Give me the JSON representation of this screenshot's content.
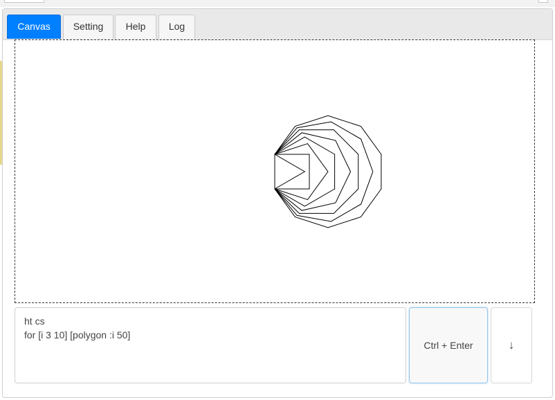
{
  "tabs": [
    {
      "label": "Canvas",
      "active": true
    },
    {
      "label": "Setting",
      "active": false
    },
    {
      "label": "Help",
      "active": false
    },
    {
      "label": "Log",
      "active": false
    }
  ],
  "editor": {
    "lines": [
      "ht cs",
      "for [i 3 10] [polygon :i 50]"
    ]
  },
  "buttons": {
    "run_label": "Ctrl + Enter",
    "down_label": "↓"
  },
  "drawing": {
    "shape": "polygon",
    "sides_from": 3,
    "sides_to": 10,
    "side_length": 50,
    "stroke_color": "#000000"
  },
  "colors": {
    "accent": "#007fff",
    "tab_bar": "#e9e9e9"
  }
}
